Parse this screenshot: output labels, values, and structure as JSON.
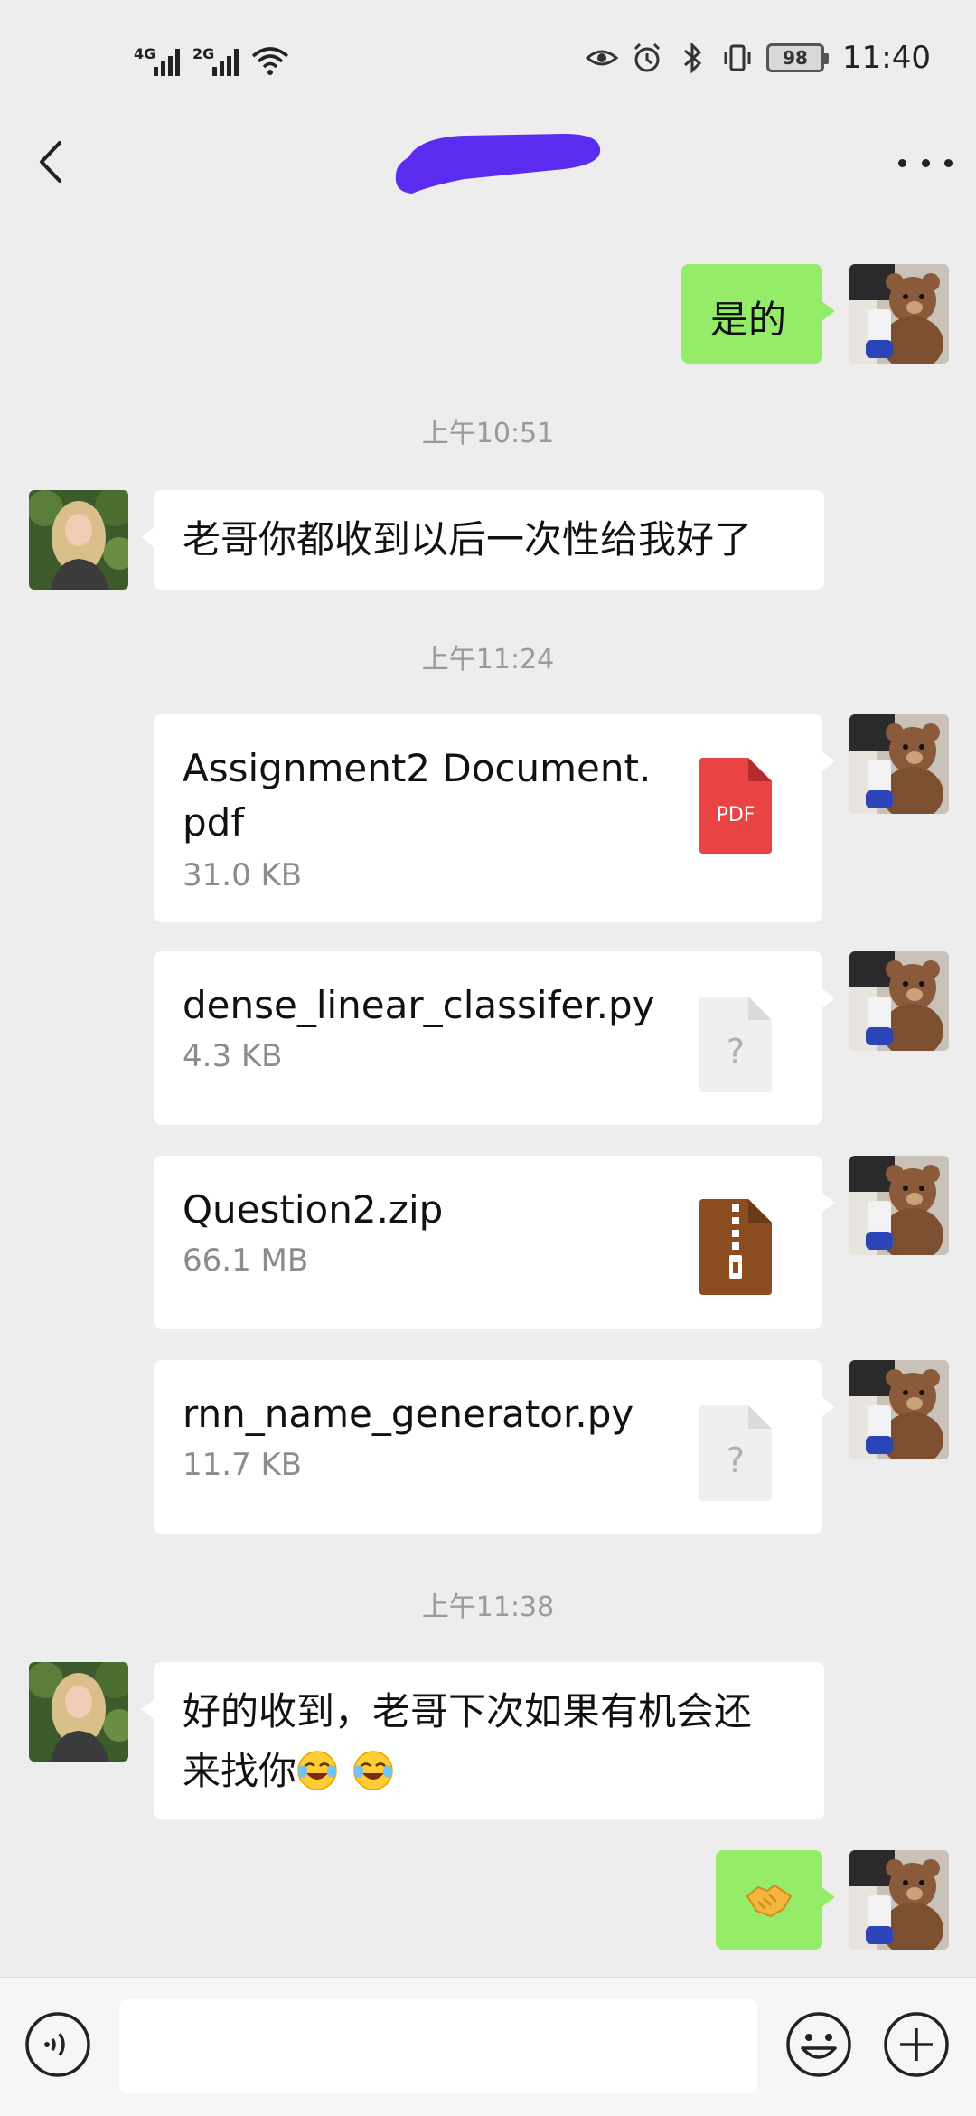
{
  "status_bar": {
    "network1": "4G",
    "network2": "2G",
    "battery": "98",
    "time": "11:40",
    "icons": [
      "eye-icon",
      "alarm-icon",
      "bluetooth-icon",
      "vibrate-icon",
      "wifi-icon"
    ]
  },
  "header": {
    "back_icon": "chevron-left-icon",
    "more_icon": "more-dots-icon",
    "title_redaction_color": "#5b2cf0"
  },
  "messages": [
    {
      "type": "text",
      "direction": "out",
      "text": "是的"
    },
    {
      "type": "timestamp",
      "text": "上午10:51"
    },
    {
      "type": "text",
      "direction": "in",
      "text": "老哥你都收到以后一次性给我好了"
    },
    {
      "type": "timestamp",
      "text": "上午11:24"
    },
    {
      "type": "file",
      "direction": "out",
      "name": "Assignment2 Document.pdf",
      "size": "31.0 KB",
      "icon": "pdf-file-icon",
      "icon_label": "PDF"
    },
    {
      "type": "file",
      "direction": "out",
      "name": "dense_linear_classifer.py",
      "size": "4.3 KB",
      "icon": "unknown-file-icon",
      "icon_label": "?"
    },
    {
      "type": "file",
      "direction": "out",
      "name": "Question2.zip",
      "size": "66.1 MB",
      "icon": "zip-file-icon"
    },
    {
      "type": "file",
      "direction": "out",
      "name": "rnn_name_generator.py",
      "size": "11.7 KB",
      "icon": "unknown-file-icon",
      "icon_label": "?"
    },
    {
      "type": "timestamp",
      "text": "上午11:38"
    },
    {
      "type": "text",
      "direction": "in",
      "text_line1": "好的收到，老哥下次如果有机会还",
      "text_line2": "来找你",
      "emoji": [
        "tears-of-joy-emoji",
        "tears-of-joy-emoji"
      ]
    },
    {
      "type": "sticker",
      "direction": "out",
      "emoji": "handshake-emoji"
    }
  ],
  "input_bar": {
    "voice_icon": "voice-icon",
    "emoji_icon": "emoji-icon",
    "plus_icon": "plus-icon",
    "placeholder": ""
  },
  "colors": {
    "background": "#ededed",
    "outgoing_bubble": "#95ec69",
    "incoming_bubble": "#ffffff",
    "pdf_icon": "#e94343",
    "zip_icon": "#8b4d1f"
  }
}
